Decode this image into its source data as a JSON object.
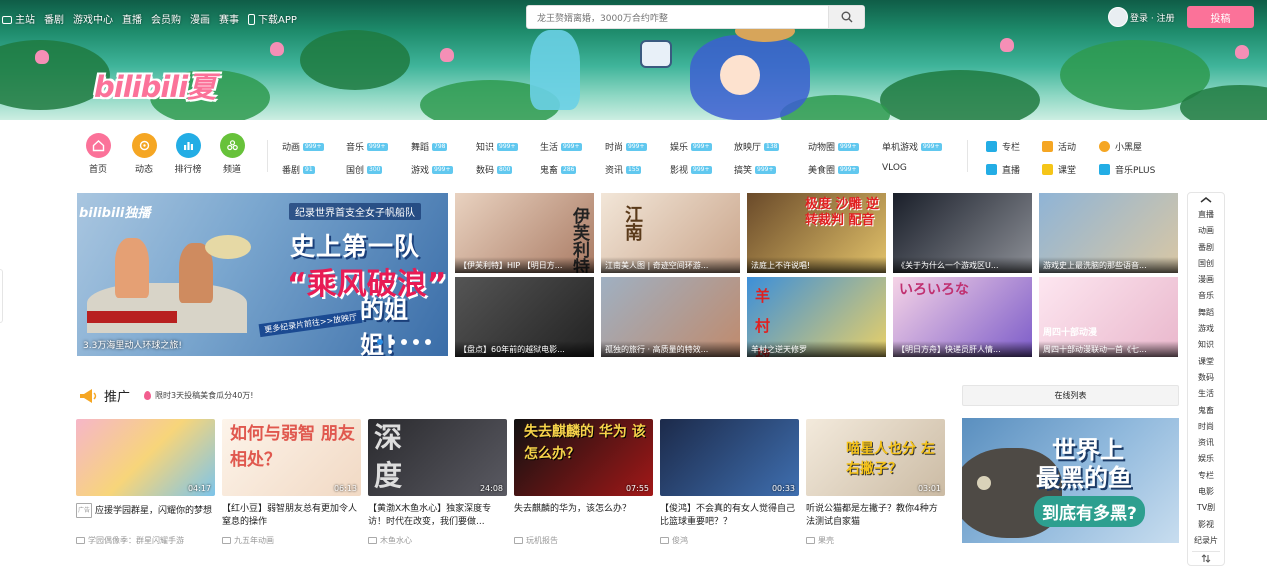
{
  "topnav": {
    "items": [
      "主站",
      "番剧",
      "游戏中心",
      "直播",
      "会员购",
      "漫画",
      "赛事"
    ],
    "download": "下载APP"
  },
  "search": {
    "placeholder": "龙王赘婿离婚，3000万合约咋整"
  },
  "user": {
    "login": "登录 · 注册",
    "upload": "投稿"
  },
  "logo": "bilibili夏",
  "quicknav": [
    {
      "label": "首页",
      "color": "#fb7299"
    },
    {
      "label": "动态",
      "color": "#f5a623"
    },
    {
      "label": "排行榜",
      "color": "#23ade5"
    },
    {
      "label": "频道",
      "color": "#67c23a"
    }
  ],
  "categories": [
    {
      "name": "动画",
      "badge": "999+"
    },
    {
      "name": "音乐",
      "badge": "999+"
    },
    {
      "name": "舞蹈",
      "badge": "798"
    },
    {
      "name": "知识",
      "badge": "999+"
    },
    {
      "name": "生活",
      "badge": "999+"
    },
    {
      "name": "时尚",
      "badge": "999+"
    },
    {
      "name": "娱乐",
      "badge": "999+"
    },
    {
      "name": "放映厅",
      "badge": "138"
    },
    {
      "name": "动物圈",
      "badge": "999+"
    },
    {
      "name": "单机游戏",
      "badge": "999+"
    },
    {
      "name": "番剧",
      "badge": "91"
    },
    {
      "name": "国创",
      "badge": "300"
    },
    {
      "name": "游戏",
      "badge": "999+"
    },
    {
      "name": "数码",
      "badge": "800"
    },
    {
      "name": "鬼畜",
      "badge": "286"
    },
    {
      "name": "资讯",
      "badge": "155"
    },
    {
      "name": "影视",
      "badge": "999+"
    },
    {
      "name": "搞笑",
      "badge": "999+"
    },
    {
      "name": "美食圈",
      "badge": "999+"
    },
    {
      "name": "VLOG",
      "badge": ""
    }
  ],
  "rightlinks": [
    {
      "label": "专栏",
      "color": "#23ade5"
    },
    {
      "label": "活动",
      "color": "#f5a623"
    },
    {
      "label": "小黑屋",
      "color": "#f5a623"
    },
    {
      "label": "直播",
      "color": "#23ade5"
    },
    {
      "label": "课堂",
      "color": "#f5c518"
    },
    {
      "label": "音乐PLUS",
      "color": "#23ade5"
    }
  ],
  "hero": {
    "brand": "bilibili独播",
    "tag": "纪录世界首支全女子帆船队",
    "headline1": "史上第一队",
    "headline2": "“乘风破浪”",
    "headline3": "的姐姐！",
    "subline": "更多纪录片前往>>放映厅",
    "caption": "3.3万海里动人环球之旅!"
  },
  "thumbs": [
    {
      "caption": "【伊芙利特】HIP 【明日方...",
      "overlay": "伊芙利特"
    },
    {
      "caption": "江南美人图 | 奇迹空间环游...",
      "overlay": "江南"
    },
    {
      "caption": "法庭上不许说唱!",
      "overlay": "极度 沙雕 逆转裁判 配音"
    },
    {
      "caption": "《关于为什么一个游戏区U...",
      "overlay": ""
    },
    {
      "caption": "游戏史上最洗脑的那些语音...",
      "overlay": ""
    },
    {
      "caption": "【盘点】60年前的越狱电影...",
      "overlay": ""
    },
    {
      "caption": "孤独的旅行 · 高质量的特效...",
      "overlay": ""
    },
    {
      "caption": "羊村之逆天修罗",
      "overlay": "羊 村 战 神"
    },
    {
      "caption": "【明日方舟】快递员肝人情...",
      "overlay": "いろいろな"
    },
    {
      "caption": "周四十部动漫联动一首《七...",
      "overlay": "周四十部动漫"
    }
  ],
  "promo": {
    "title": "推广",
    "subtitle": "限时3天投稿美食瓜分40万!"
  },
  "videos": [
    {
      "duration": "04:17",
      "title": "应援学园群星，闪耀你的梦想",
      "uploader": "学园偶像季：群星闪耀手游",
      "ad": "广告",
      "overlay": ""
    },
    {
      "duration": "06:13",
      "title": "【红小豆】弱智朋友总有更加令人窒息的操作",
      "uploader": "九五年动画",
      "ad": "",
      "overlay": "如何与弱智 朋友相处？"
    },
    {
      "duration": "24:08",
      "title": "【黄渤X木鱼水心】独家深度专访！时代在改变，我们要做...",
      "uploader": "木鱼水心",
      "ad": "",
      "overlay": "深度 专访"
    },
    {
      "duration": "07:55",
      "title": "失去麒麟的华为，该怎么办？",
      "uploader": "玩机报告",
      "ad": "",
      "overlay": "失去麒麟的 华为 该怎么办？"
    },
    {
      "duration": "00:33",
      "title": "【俊鸿】不会真的有女人觉得自己比篮球重要吧？？",
      "uploader": "俊鸿",
      "ad": "",
      "overlay": ""
    },
    {
      "duration": "03:01",
      "title": "听说公猫都是左撇子？教你4种方法测试自家猫",
      "uploader": "果壳",
      "ad": "",
      "overlay": "喵星人也分 左右撇子？"
    }
  ],
  "live": {
    "button": "在线列表",
    "headline1": "世界上",
    "headline2": "最黑的鱼",
    "headline3": "到底有多黑?"
  },
  "sidebar": [
    "直播",
    "动画",
    "番剧",
    "国创",
    "漫画",
    "音乐",
    "舞蹈",
    "游戏",
    "知识",
    "课堂",
    "数码",
    "生活",
    "鬼畜",
    "时尚",
    "资讯",
    "娱乐",
    "专栏",
    "电影",
    "TV剧",
    "影视",
    "纪录片"
  ]
}
